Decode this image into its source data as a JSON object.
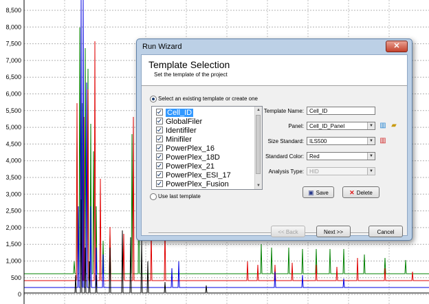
{
  "plot": {
    "y_ticks": [
      "8,500",
      "8,000",
      "7,500",
      "7,000",
      "6,500",
      "6,000",
      "5,500",
      "5,000",
      "4,500",
      "4,000",
      "3,500",
      "3,000",
      "2,500",
      "2,000",
      "1,500",
      "1,000",
      "500",
      "0"
    ],
    "series_colors": {
      "green": "#008000",
      "red": "#e00000",
      "blue": "#0000e0",
      "black": "#000000"
    }
  },
  "dialog": {
    "title": "Run Wizard",
    "close_glyph": "✕",
    "header_title": "Template Selection",
    "header_subtitle": "Set the template of the project",
    "option_select": "Select an existing template or create one",
    "option_last": "Use last template",
    "templates": [
      "Cell_ID",
      "GlobalFiler",
      "Identifiler",
      "Minifiler",
      "PowerPlex_16",
      "PowerPlex_18D",
      "PowerPlex_21",
      "PowerPlex_ESI_17",
      "PowerPlex_Fusion"
    ],
    "selected_template": "Cell_ID",
    "fields": {
      "template_name_label": "Template Name:",
      "template_name_value": "Cell_ID",
      "panel_label": "Panel:",
      "panel_value": "Cell_ID_Panel",
      "size_standard_label": "Size Standard:",
      "size_standard_value": "ILS500",
      "standard_color_label": "Standard Color:",
      "standard_color_value": "Red",
      "analysis_type_label": "Analysis Type:",
      "analysis_type_value": "HID"
    },
    "buttons": {
      "save": "Save",
      "delete": "Delete",
      "back": "<< Back",
      "next": "Next >>",
      "cancel": "Cancel"
    },
    "icons": {
      "panel_chart": "bar-chart-icon",
      "panel_folder": "folder-open-icon",
      "size_chart": "size-chart-icon",
      "save": "floppy-disk-icon",
      "delete": "red-x-icon"
    }
  }
}
